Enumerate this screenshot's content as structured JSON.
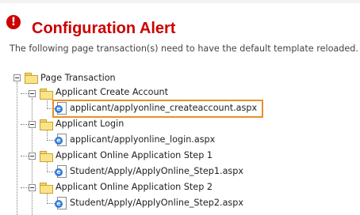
{
  "alert": {
    "icon": "alert-icon",
    "icon_glyph": "!",
    "title": "Configuration Alert",
    "description": "The following page transaction(s) need to have the default template reloaded.",
    "title_color": "#cc0000",
    "highlight_color": "#e5902b"
  },
  "tree": {
    "root": {
      "label": "Page Transaction",
      "expanded": true
    },
    "groups": [
      {
        "label": "Applicant Create Account",
        "expanded": true,
        "page": "applicant/applyonline_createaccount.aspx",
        "highlighted": true
      },
      {
        "label": "Applicant Login",
        "expanded": true,
        "page": "applicant/applyonline_login.aspx",
        "highlighted": false
      },
      {
        "label": "Applicant Online Application Step 1",
        "expanded": true,
        "page": "Student/Apply/ApplyOnline_Step1.aspx",
        "highlighted": false
      },
      {
        "label": "Applicant Online Application Step 2",
        "expanded": true,
        "page": "Student/Apply/ApplyOnline_Step2.aspx",
        "highlighted": false
      }
    ]
  }
}
